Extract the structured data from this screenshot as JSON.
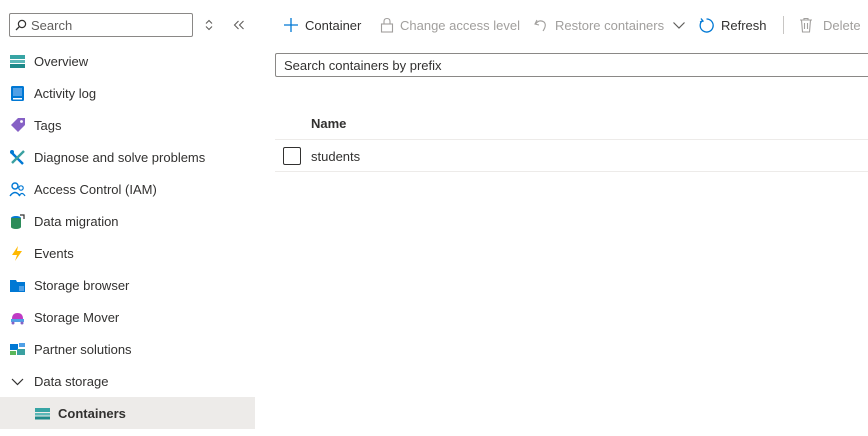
{
  "sidebar": {
    "search_placeholder": "Search",
    "items": [
      {
        "label": "Overview",
        "icon": "overview-icon"
      },
      {
        "label": "Activity log",
        "icon": "activity-log-icon"
      },
      {
        "label": "Tags",
        "icon": "tag-icon"
      },
      {
        "label": "Diagnose and solve problems",
        "icon": "wrench-icon"
      },
      {
        "label": "Access Control (IAM)",
        "icon": "people-icon"
      },
      {
        "label": "Data migration",
        "icon": "data-migration-icon"
      },
      {
        "label": "Events",
        "icon": "lightning-icon"
      },
      {
        "label": "Storage browser",
        "icon": "storage-browser-icon"
      },
      {
        "label": "Storage Mover",
        "icon": "storage-mover-icon"
      },
      {
        "label": "Partner solutions",
        "icon": "partner-solutions-icon"
      },
      {
        "label": "Data storage",
        "icon": "chevron-down-icon"
      },
      {
        "label": "Containers",
        "icon": "containers-icon",
        "selected": true
      }
    ]
  },
  "toolbar": {
    "add_container": "Container",
    "change_access": "Change access level",
    "restore": "Restore containers",
    "refresh": "Refresh",
    "delete": "Delete"
  },
  "filter": {
    "placeholder": "Search containers by prefix"
  },
  "table": {
    "columns": [
      "Name"
    ],
    "rows": [
      {
        "name": "students"
      }
    ]
  },
  "colors": {
    "accent": "#0078d4",
    "disabled": "#a19f9d",
    "selected_bg": "#edebe9"
  }
}
